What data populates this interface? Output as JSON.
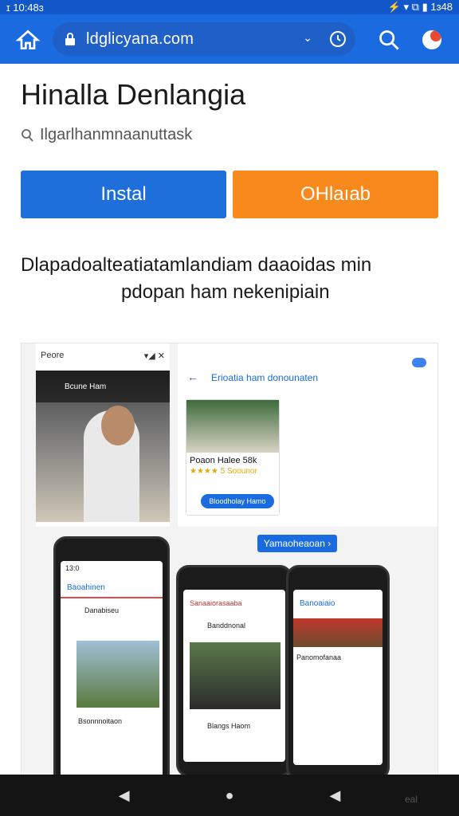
{
  "status": {
    "time": "ɪ 10:48ɜ",
    "right": "⚡ ▾ ⧉ ▮ 1ɜ48"
  },
  "browser": {
    "url": "ldglicyana.com",
    "dropdown_mark": "⌄",
    "icons": [
      "home-icon",
      "lock-icon",
      "reload-icon",
      "search-icon",
      "profile-icon"
    ]
  },
  "app": {
    "title": "Hinalla Denlangia",
    "developer": "Ilgarlhanmnaanuttask",
    "install_label": "Instal",
    "other_label": "OHlaıab",
    "description_line1": "Dlapadoalteatiatamlandiam daaoidas min",
    "description_line2": "pdopan ham nekenipiain"
  },
  "gallery": {
    "left_status": "Peore",
    "left_header": "Bcune Ham",
    "right_topic": "Erioatia ham donounaten",
    "card_title": "Poaon Halee 58k",
    "card_stars": "★★★★ 5 Soounor",
    "card_chip": "Bloodholay Hamo",
    "more_button": "Yamaoheaoan ›",
    "phone1_status": "13:0",
    "phone1_title": "Baoahinen",
    "phone1_item": "Danabiseu",
    "phone1_footer": "Bsonnnoitaon",
    "phone2_title": "Sanaaiorasaaba",
    "phone2_item": "Banddnonal",
    "phone2_footer": "Blangs Haom",
    "phone3_title": "Banoaiaio",
    "phone3_item": "Panomofanaa"
  },
  "nav": {
    "back": "◀",
    "home": "●",
    "recent": "◀",
    "corner_text": "eal"
  }
}
